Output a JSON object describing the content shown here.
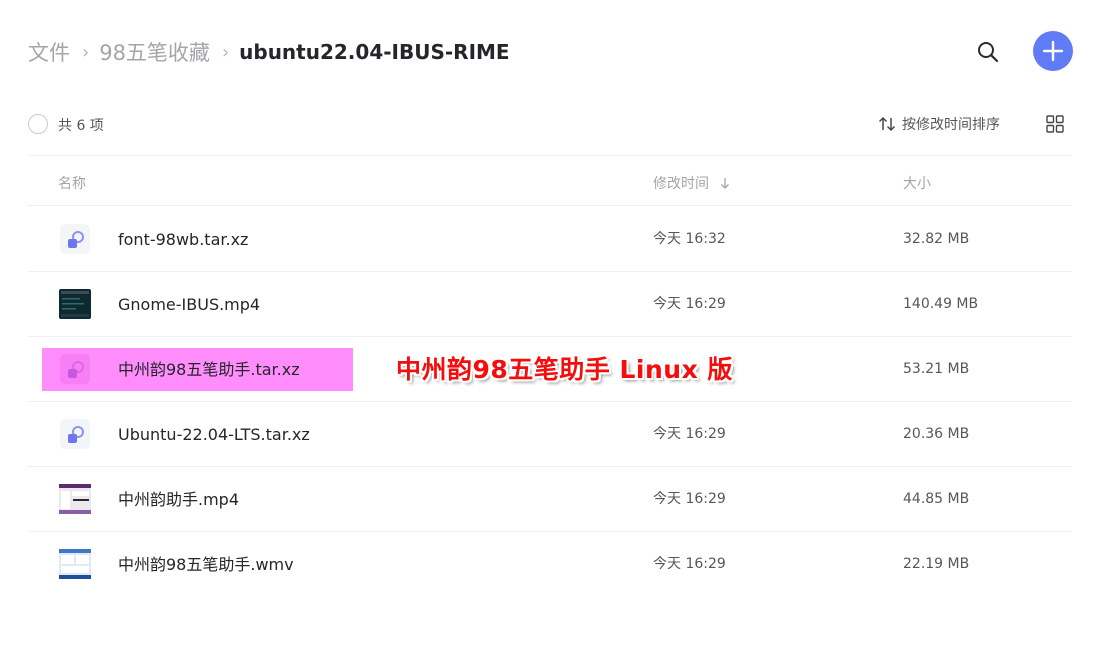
{
  "breadcrumb": {
    "items": [
      "文件",
      "98五笔收藏"
    ],
    "current": "ubuntu22.04-IBUS-RIME",
    "separator": "›"
  },
  "header": {
    "search_icon": "search-icon",
    "add_icon": "plus-icon",
    "accent_color": "#5f7cf6"
  },
  "toolbar": {
    "count_label": "共 6 项",
    "sort_label": "按修改时间排序",
    "sort_icon": "sort-arrows-icon",
    "view_icon": "grid-view-icon"
  },
  "table": {
    "columns": {
      "name": "名称",
      "time": "修改时间",
      "size": "大小"
    },
    "sort_direction_icon": "arrow-down-icon"
  },
  "files": [
    {
      "name": "font-98wb.tar.xz",
      "time": "今天 16:32",
      "size": "32.82 MB",
      "icon": "archive-file-icon"
    },
    {
      "name": "Gnome-IBUS.mp4",
      "time": "今天 16:29",
      "size": "140.49 MB",
      "icon": "video-thumbnail-icon"
    },
    {
      "name": "中州韵98五笔助手.tar.xz",
      "time": "",
      "size": "53.21 MB",
      "icon": "archive-file-icon",
      "highlight_color": "#ff8efc"
    },
    {
      "name": "Ubuntu-22.04-LTS.tar.xz",
      "time": "今天 16:29",
      "size": "20.36 MB",
      "icon": "archive-file-icon"
    },
    {
      "name": "中州韵助手.mp4",
      "time": "今天 16:29",
      "size": "44.85 MB",
      "icon": "video-thumbnail-icon"
    },
    {
      "name": "中州韵98五笔助手.wmv",
      "time": "今天 16:29",
      "size": "22.19 MB",
      "icon": "video-thumbnail-icon"
    }
  ],
  "annotation": {
    "text": "中州韵98五笔助手 Linux 版",
    "color": "#f50c0c"
  }
}
